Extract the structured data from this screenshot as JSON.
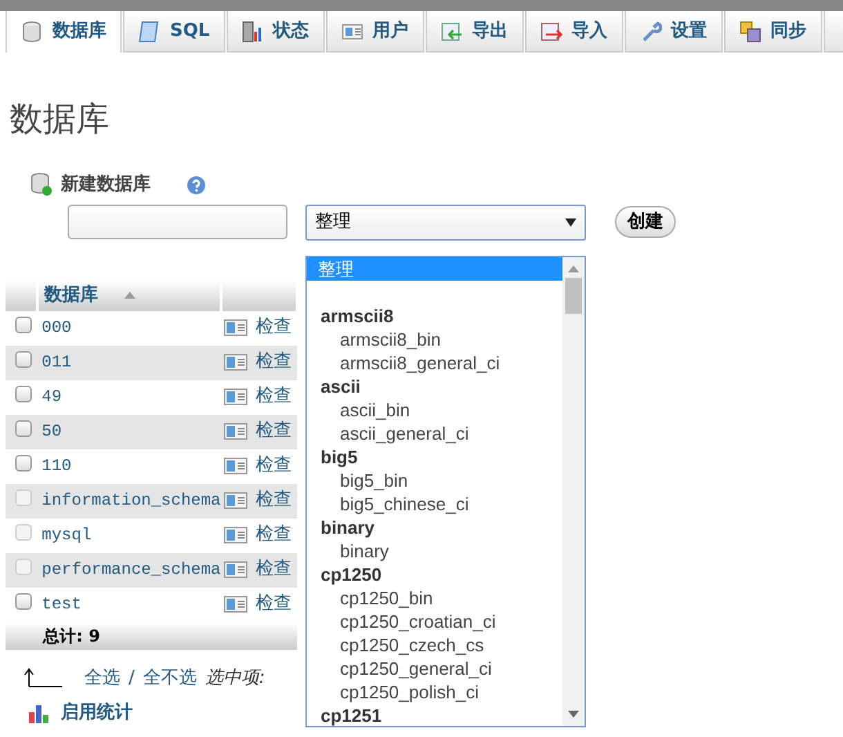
{
  "tabs": [
    {
      "label": "数据库",
      "selected": true
    },
    {
      "label": "SQL",
      "selected": false
    },
    {
      "label": "状态",
      "selected": false
    },
    {
      "label": "用户",
      "selected": false
    },
    {
      "label": "导出",
      "selected": false
    },
    {
      "label": "导入",
      "selected": false
    },
    {
      "label": "设置",
      "selected": false
    },
    {
      "label": "同步",
      "selected": false
    }
  ],
  "page_title": "数据库",
  "create_database": {
    "label": "新建数据库",
    "collation": "整理",
    "button": "创建"
  },
  "collation_options": [
    {
      "kind": "default",
      "label": "整理",
      "selected": true
    },
    {
      "kind": "group",
      "label": "armscii8",
      "options": [
        "armscii8_bin",
        "armscii8_general_ci"
      ]
    },
    {
      "kind": "group",
      "label": "ascii",
      "options": [
        "ascii_bin",
        "ascii_general_ci"
      ]
    },
    {
      "kind": "group",
      "label": "big5",
      "options": [
        "big5_bin",
        "big5_chinese_ci"
      ]
    },
    {
      "kind": "group",
      "label": "binary",
      "options": [
        "binary"
      ]
    },
    {
      "kind": "group",
      "label": "cp1250",
      "options": [
        "cp1250_bin",
        "cp1250_croatian_ci",
        "cp1250_czech_cs",
        "cp1250_general_ci",
        "cp1250_polish_ci"
      ]
    },
    {
      "kind": "group",
      "label": "cp1251"
    }
  ],
  "table": {
    "column_header": "数据库",
    "rows": [
      {
        "name": "000",
        "action": "检查",
        "disabled": false
      },
      {
        "name": "011",
        "action": "检查",
        "disabled": false
      },
      {
        "name": "49",
        "action": "检查",
        "disabled": false
      },
      {
        "name": "50",
        "action": "检查",
        "disabled": false
      },
      {
        "name": "110",
        "action": "检查",
        "disabled": false
      },
      {
        "name": "information_schema",
        "action": "检查",
        "disabled": true
      },
      {
        "name": "mysql",
        "action": "检查",
        "disabled": true
      },
      {
        "name": "performance_schema",
        "action": "检查",
        "disabled": true
      },
      {
        "name": "test",
        "action": "检查",
        "disabled": false
      }
    ],
    "total": "总计: 9"
  },
  "selection": {
    "select_all": "全选",
    "separator": "/",
    "select_none": "全不选",
    "with_selected": "选中项:"
  },
  "statistics": "启用统计"
}
